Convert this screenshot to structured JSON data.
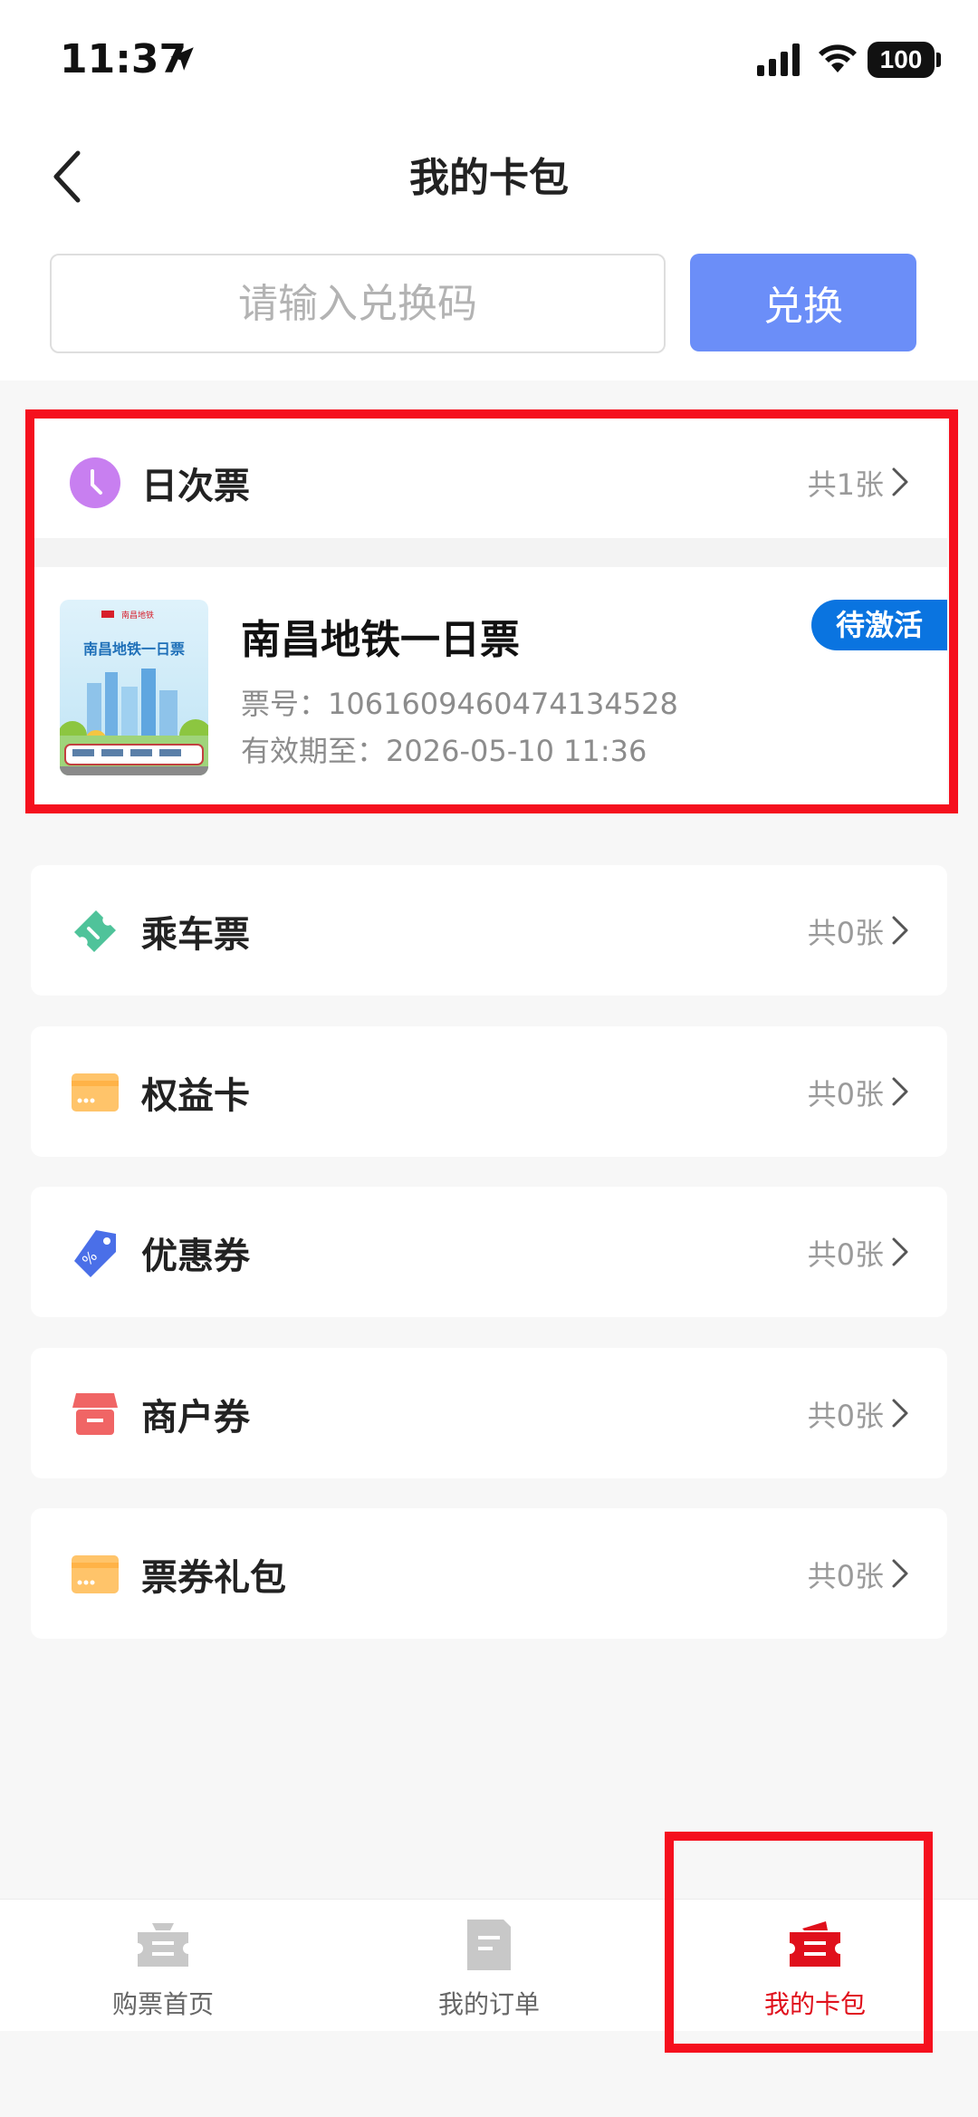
{
  "status": {
    "time": "11:37",
    "battery": "100"
  },
  "header": {
    "title": "我的卡包"
  },
  "redeem": {
    "placeholder": "请输入兑换码",
    "button_label": "兑换"
  },
  "day_ticket": {
    "title": "日次票",
    "count": "共1张",
    "card": {
      "name": "南昌地铁一日票",
      "ticket_no": "票号：1061609460474134528",
      "expiry": "有效期至：2026-05-10 11:36",
      "status": "待激活",
      "thumb_logo_text": "南昌地铁",
      "thumb_caption": "南昌地铁一日票"
    }
  },
  "sections": [
    {
      "title": "乘车票",
      "count": "共0张",
      "icon": "ticket-icon",
      "color": "#4fc39a"
    },
    {
      "title": "权益卡",
      "count": "共0张",
      "icon": "card-icon",
      "color": "#ffc46a"
    },
    {
      "title": "优惠券",
      "count": "共0张",
      "icon": "coupon-tag-icon",
      "color": "#4a6fe8"
    },
    {
      "title": "商户券",
      "count": "共0张",
      "icon": "store-icon",
      "color": "#f06565"
    },
    {
      "title": "票券礼包",
      "count": "共0张",
      "icon": "gift-card-icon",
      "color": "#ffc46a"
    }
  ],
  "tabs": [
    {
      "label": "购票首页",
      "icon": "ticket-home-icon",
      "active": false
    },
    {
      "label": "我的订单",
      "icon": "order-doc-icon",
      "active": false
    },
    {
      "label": "我的卡包",
      "icon": "wallet-ticket-icon",
      "active": true
    }
  ],
  "colors": {
    "accent_blue": "#6b8ef8",
    "active_red": "#e0101c",
    "badge_blue": "#0a74e0",
    "highlight_red": "#f5101e"
  }
}
